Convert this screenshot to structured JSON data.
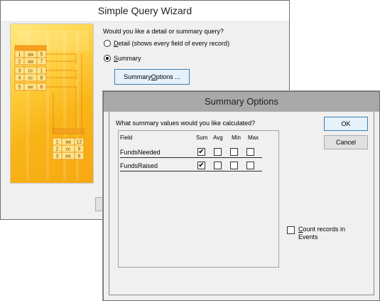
{
  "wizard": {
    "title": "Simple Query Wizard",
    "question": "Would you like a detail or summary query?",
    "detail_option": {
      "label_mnemonic": "D",
      "label_rest": "etail (shows every field of every record)",
      "selected": false
    },
    "summary_option": {
      "label_mnemonic": "S",
      "label_rest": "ummary",
      "selected": true
    },
    "summary_button": {
      "label_prefix": "Summary ",
      "label_mnemonic": "O",
      "label_rest": "ptions ..."
    },
    "graphic": {
      "left_rows": [
        [
          "1",
          "aa",
          "5"
        ],
        [
          "2",
          "aa",
          "7"
        ],
        [
          "3",
          "cc",
          "1"
        ],
        [
          "4",
          "cc",
          "8"
        ],
        [
          "5",
          "ee",
          "6"
        ]
      ],
      "right_rows": [
        [
          "1",
          "aa",
          "12"
        ],
        [
          "2",
          "cc",
          "9"
        ],
        [
          "3",
          "ee",
          "6"
        ]
      ]
    }
  },
  "dialog": {
    "title": "Summary Options",
    "question": "What summary values would you like calculated?",
    "ok_label": "OK",
    "cancel_label": "Cancel",
    "columns": [
      "Field",
      "Sum",
      "Avg",
      "Min",
      "Max"
    ],
    "rows": [
      {
        "field": "FundsNeeded",
        "sum": true,
        "avg": false,
        "min": false,
        "max": false
      },
      {
        "field": "FundsRaised",
        "sum": true,
        "avg": false,
        "min": false,
        "max": false
      }
    ],
    "count_records": {
      "mnemonic": "C",
      "line1_rest": "ount records in",
      "line2": "Events",
      "checked": false
    }
  },
  "check_glyph": "✔"
}
